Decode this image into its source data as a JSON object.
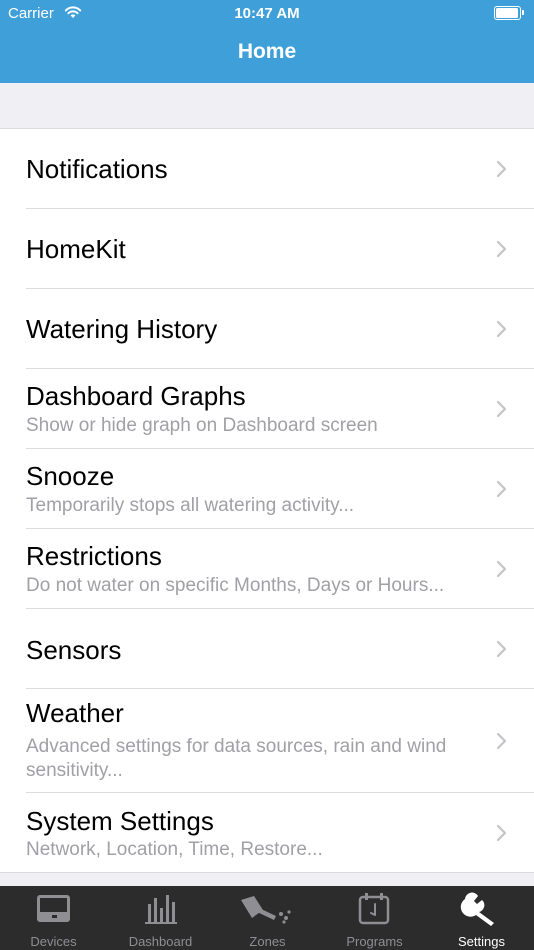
{
  "status_bar": {
    "carrier": "Carrier",
    "time": "10:47 AM"
  },
  "nav": {
    "title": "Home"
  },
  "settings_list": [
    {
      "title": "Notifications",
      "subtitle": ""
    },
    {
      "title": "HomeKit",
      "subtitle": ""
    },
    {
      "title": "Watering History",
      "subtitle": ""
    },
    {
      "title": "Dashboard Graphs",
      "subtitle": "Show or hide graph on Dashboard screen"
    },
    {
      "title": "Snooze",
      "subtitle": "Temporarily stops all watering activity..."
    },
    {
      "title": "Restrictions",
      "subtitle": "Do not water on specific Months, Days or Hours..."
    },
    {
      "title": "Sensors",
      "subtitle": ""
    },
    {
      "title": "Weather",
      "subtitle": "Advanced settings for data sources, rain and wind sensitivity..."
    },
    {
      "title": "System Settings",
      "subtitle": "Network, Location, Time, Restore..."
    }
  ],
  "tab_bar": {
    "active": "Settings",
    "tabs": [
      {
        "label": "Devices",
        "icon": "device-icon"
      },
      {
        "label": "Dashboard",
        "icon": "bar-chart-icon"
      },
      {
        "label": "Zones",
        "icon": "watering-can-icon"
      },
      {
        "label": "Programs",
        "icon": "calendar-icon"
      },
      {
        "label": "Settings",
        "icon": "wrench-icon"
      }
    ]
  },
  "colors": {
    "nav_bar": "#3f9fd8",
    "tab_bar": "#2c2c2c",
    "subtitle": "#a0a0a6",
    "tab_inactive": "#8e8e93"
  }
}
